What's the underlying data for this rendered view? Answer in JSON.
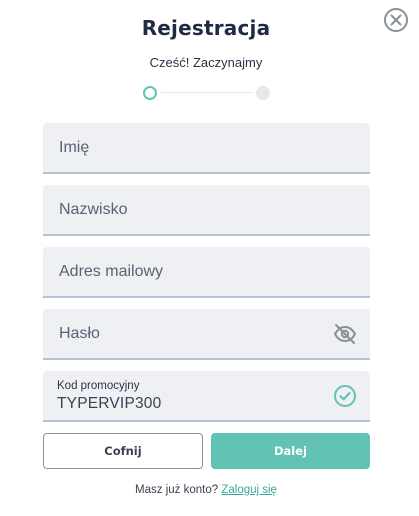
{
  "header": {
    "title": "Rejestracja",
    "subtitle": "Cześć! Zaczynajmy"
  },
  "stepper": {
    "current_step": 1,
    "total_steps": 2
  },
  "form": {
    "first_name": {
      "placeholder": "Imię",
      "value": ""
    },
    "last_name": {
      "placeholder": "Nazwisko",
      "value": ""
    },
    "email": {
      "placeholder": "Adres mailowy",
      "value": ""
    },
    "password": {
      "placeholder": "Hasło",
      "value": ""
    },
    "promo": {
      "label": "Kod promocyjny",
      "value": "TYPERVIP300"
    }
  },
  "buttons": {
    "back_label": "Cofnij",
    "next_label": "Dalej"
  },
  "footer": {
    "prompt": "Masz już konto?",
    "login_link": "Zaloguj się"
  },
  "icons": {
    "close": "close-icon",
    "password_toggle": "eye-off-icon",
    "promo_valid": "check-circle-icon"
  },
  "colors": {
    "accent": "#62c2b3",
    "title": "#1f2a44",
    "field_bg": "#eef0f3"
  }
}
